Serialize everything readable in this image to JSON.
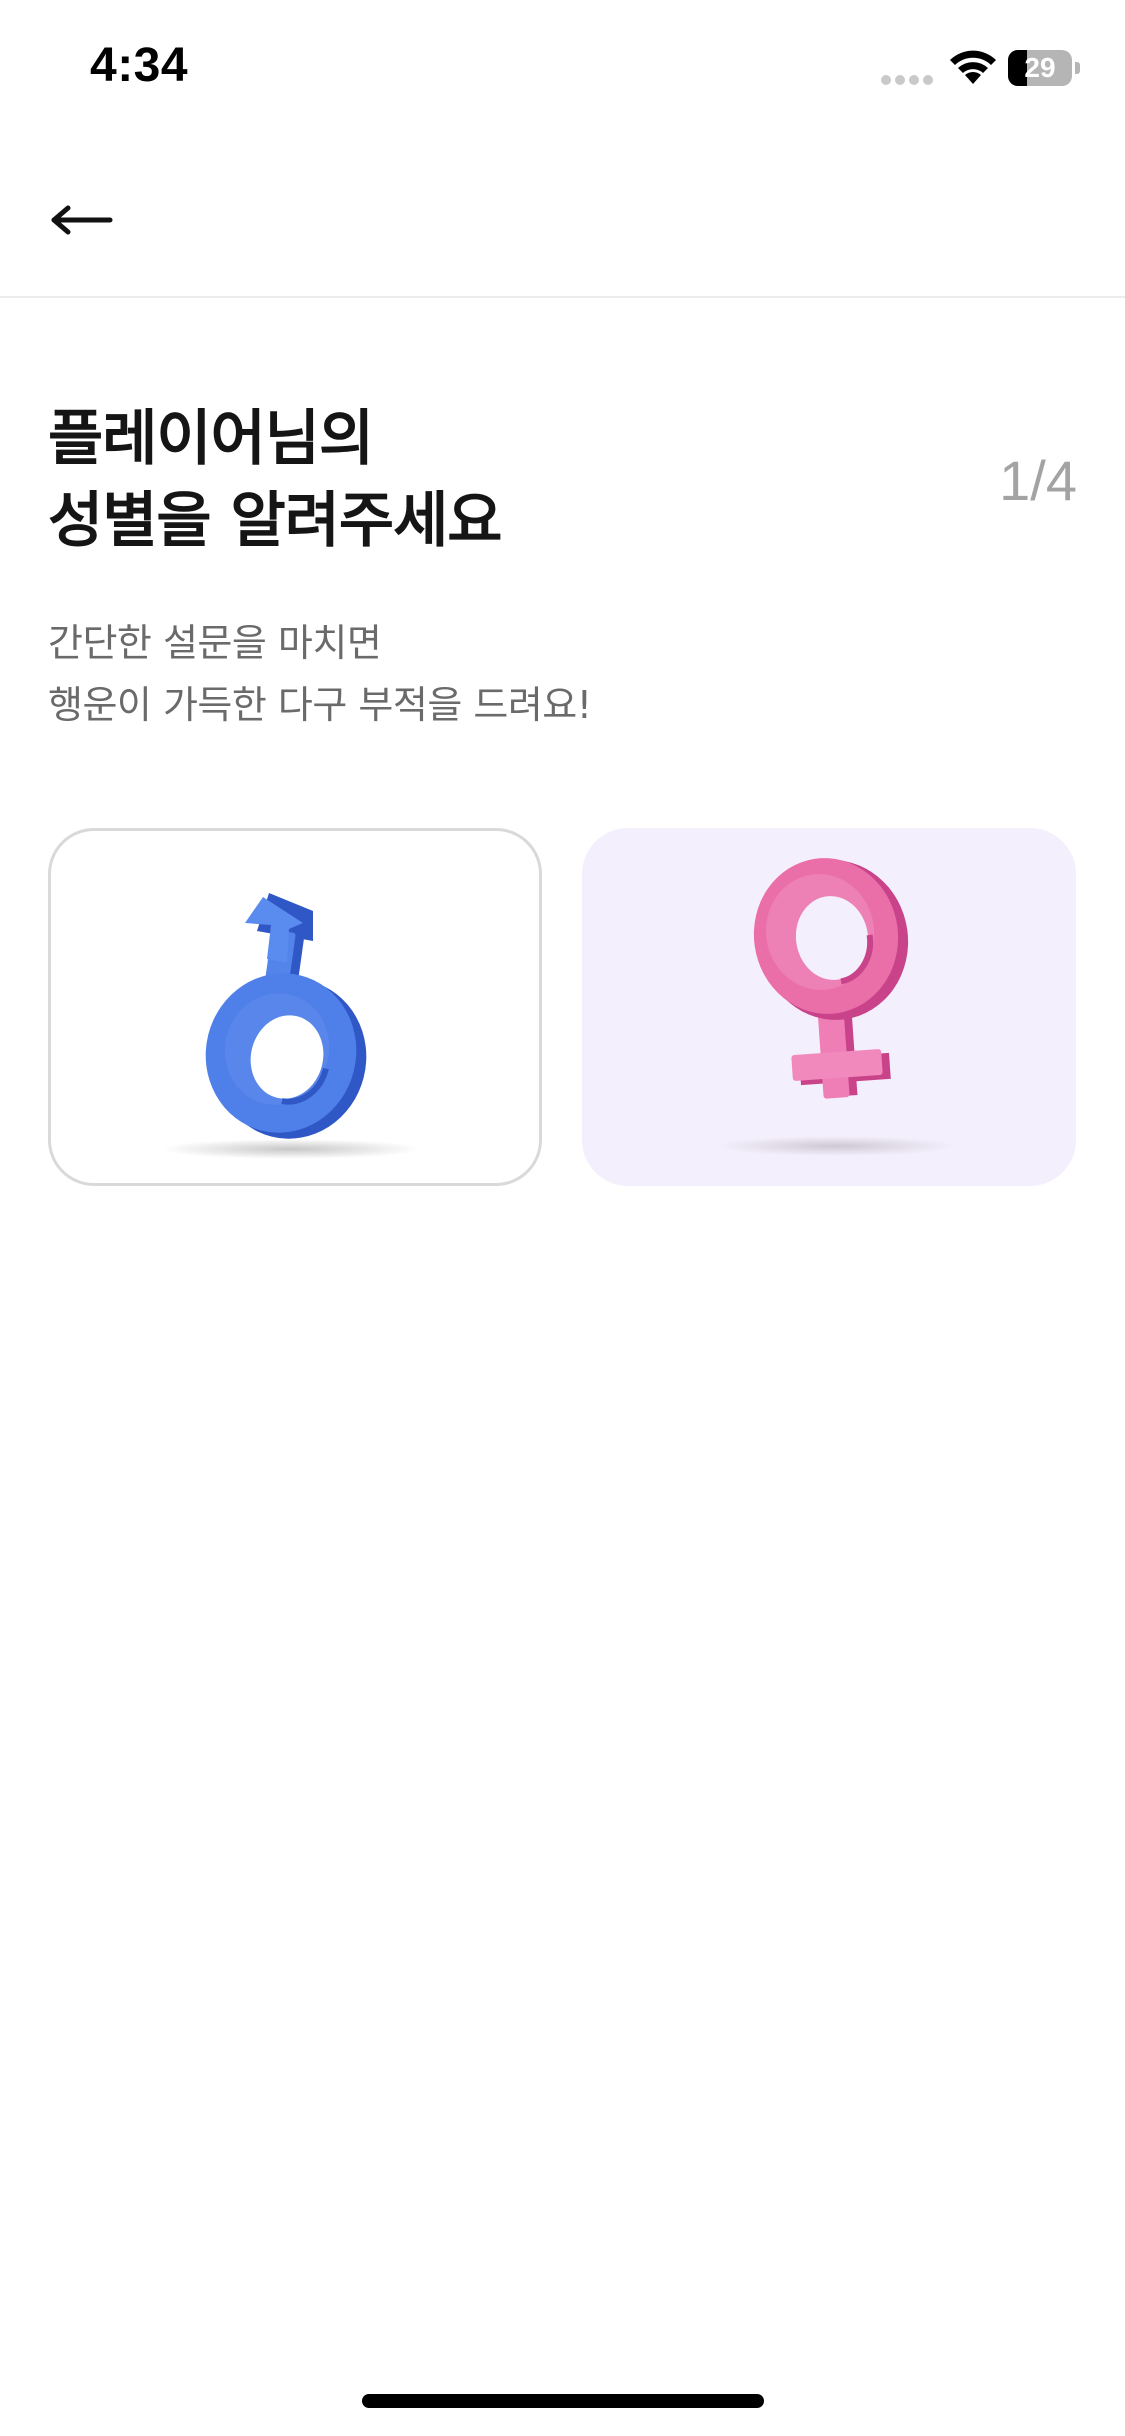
{
  "status_bar": {
    "time": "4:34",
    "battery_level": "29",
    "battery_fraction": 0.29
  },
  "nav": {
    "back_icon": "arrow-left-icon"
  },
  "header": {
    "title_line1": "플레이어님의",
    "title_line2": "성별을 알려주세요",
    "step": "1/4"
  },
  "subtitle": {
    "line1": "간단한 설문을 마치면",
    "line2": "행운이 가득한 다구 부적을 드려요!"
  },
  "options": [
    {
      "id": "male",
      "icon": "male-symbol-icon",
      "color": "#4f7fe8",
      "selected": true
    },
    {
      "id": "female",
      "icon": "female-symbol-icon",
      "color": "#ea6fa9",
      "selected": false
    }
  ],
  "colors": {
    "text_primary": "#151515",
    "text_secondary": "#6a6a6a",
    "step_indicator": "#a3a3a3",
    "female_card_bg": "#f4effc",
    "card_border": "#d9d9d9"
  }
}
